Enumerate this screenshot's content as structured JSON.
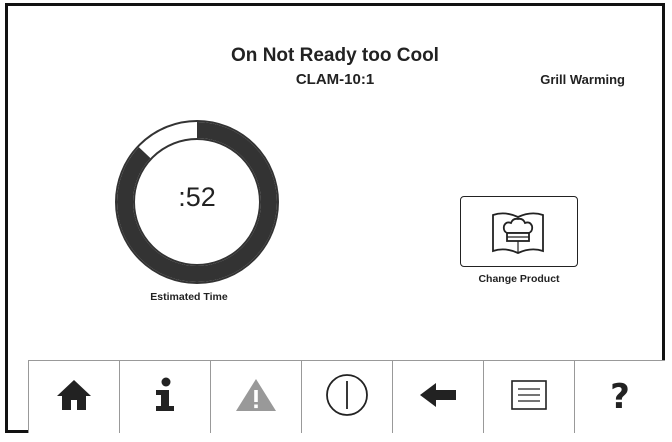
{
  "header": {
    "title": "On Not Ready too Cool",
    "subtitle": "CLAM-10:1",
    "status": "Grill Warming"
  },
  "timer": {
    "value": ":52",
    "label": "Estimated Time",
    "progress_remaining_fraction": 0.87
  },
  "change_product": {
    "label": "Change Product",
    "icon": "chef-hat-book-icon"
  },
  "navbar": {
    "items": [
      {
        "icon": "home-icon",
        "enabled": true
      },
      {
        "icon": "info-icon",
        "enabled": true
      },
      {
        "icon": "warning-icon",
        "enabled": false
      },
      {
        "icon": "power-icon",
        "enabled": true
      },
      {
        "icon": "back-arrow-icon",
        "enabled": true
      },
      {
        "icon": "menu-list-icon",
        "enabled": true
      },
      {
        "icon": "help-icon",
        "enabled": true,
        "glyph": "?"
      }
    ]
  },
  "colors": {
    "ring_dark": "#333333",
    "ring_light": "#ffffff",
    "warning_disabled": "#999999",
    "text": "#222222"
  }
}
